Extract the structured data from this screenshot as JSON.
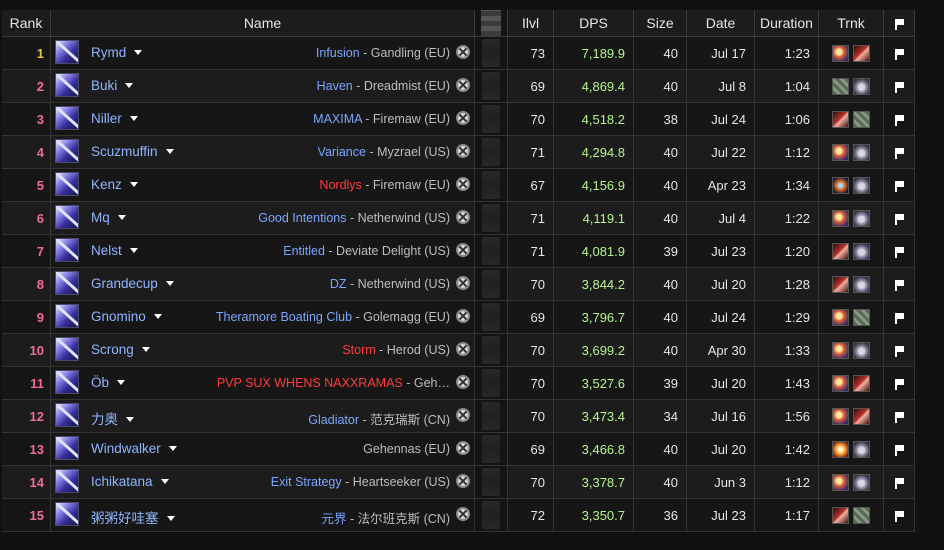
{
  "colors": {
    "rank_gold": "#e7c24a",
    "rank_pink": "#f06a9a",
    "name_blue": "#8eb6ff",
    "guild_blue": "#7aa7ff",
    "guild_red": "#ff3b3b",
    "server_gray": "#bdbdbd",
    "dps_green": "#b6f58a"
  },
  "headers": {
    "rank": "Rank",
    "name": "Name",
    "ilvl": "Ilvl",
    "dps": "DPS",
    "size": "Size",
    "date": "Date",
    "duration": "Duration",
    "trinkets": "Trnk",
    "flag_icon": "flag-icon"
  },
  "rows": [
    {
      "rank": "1",
      "name": "Rymd",
      "guild": "Infusion",
      "guild_color": "blue",
      "server": " - Gandling (EU)",
      "ilvl": "73",
      "dps": "7,189.9",
      "size": "40",
      "date": "Jul 17",
      "duration": "1:23",
      "trinkets": [
        "eye",
        "claw"
      ]
    },
    {
      "rank": "2",
      "name": "Buki",
      "guild": "Haven",
      "guild_color": "blue",
      "server": " - Dreadmist (EU)",
      "ilvl": "69",
      "dps": "4,869.4",
      "size": "40",
      "date": "Jul 8",
      "duration": "1:04",
      "trinkets": [
        "rune",
        "orb"
      ]
    },
    {
      "rank": "3",
      "name": "Niller",
      "guild": "MAXIMA",
      "guild_color": "blue",
      "server": " - Firemaw (EU)",
      "ilvl": "70",
      "dps": "4,518.2",
      "size": "38",
      "date": "Jul 24",
      "duration": "1:06",
      "trinkets": [
        "claw",
        "rune"
      ]
    },
    {
      "rank": "4",
      "name": "Scuzmuffin",
      "guild": "Variance",
      "guild_color": "blue",
      "server": " - Myzrael (US)",
      "ilvl": "71",
      "dps": "4,294.8",
      "size": "40",
      "date": "Jul 22",
      "duration": "1:12",
      "trinkets": [
        "eye",
        "orb"
      ]
    },
    {
      "rank": "5",
      "name": "Kenz",
      "guild": "Nordlys",
      "guild_color": "red",
      "server": " - Firemaw (EU)",
      "ilvl": "67",
      "dps": "4,156.9",
      "size": "40",
      "date": "Apr 23",
      "duration": "1:34",
      "trinkets": [
        "spark",
        "orb"
      ]
    },
    {
      "rank": "6",
      "name": "Mq",
      "guild": "Good Intentions",
      "guild_color": "blue",
      "server": " - Netherwind (US)",
      "ilvl": "71",
      "dps": "4,119.1",
      "size": "40",
      "date": "Jul 4",
      "duration": "1:22",
      "trinkets": [
        "eye",
        "orb"
      ]
    },
    {
      "rank": "7",
      "name": "Nelst",
      "guild": "Entitled",
      "guild_color": "blue",
      "server": " - Deviate Delight (US)",
      "ilvl": "71",
      "dps": "4,081.9",
      "size": "39",
      "date": "Jul 23",
      "duration": "1:20",
      "trinkets": [
        "claw",
        "orb"
      ]
    },
    {
      "rank": "8",
      "name": "Grandecup",
      "guild": "DZ",
      "guild_color": "blue",
      "server": " - Netherwind (US)",
      "ilvl": "70",
      "dps": "3,844.2",
      "size": "40",
      "date": "Jul 20",
      "duration": "1:28",
      "trinkets": [
        "claw",
        "orb"
      ]
    },
    {
      "rank": "9",
      "name": "Gnomino",
      "guild": "Theramore Boating Club",
      "guild_color": "blue",
      "server": " - Golemagg (EU)",
      "ilvl": "69",
      "dps": "3,796.7",
      "size": "40",
      "date": "Jul 24",
      "duration": "1:29",
      "trinkets": [
        "eye",
        "rune"
      ]
    },
    {
      "rank": "10",
      "name": "Scrong",
      "guild": "Storm",
      "guild_color": "red",
      "server": " - Herod (US)",
      "ilvl": "70",
      "dps": "3,699.2",
      "size": "40",
      "date": "Apr 30",
      "duration": "1:33",
      "trinkets": [
        "eye",
        "orb"
      ]
    },
    {
      "rank": "11",
      "name": "Öb",
      "guild": "PVP SUX WHENS NAXXRAMAS",
      "guild_color": "red",
      "server": " - Geh…",
      "ilvl": "70",
      "dps": "3,527.6",
      "size": "39",
      "date": "Jul 20",
      "duration": "1:43",
      "trinkets": [
        "eye",
        "claw"
      ]
    },
    {
      "rank": "12",
      "name": "力奥",
      "guild": "Gladiator",
      "guild_color": "blue",
      "server": " - 范克瑞斯 (CN)",
      "ilvl": "70",
      "dps": "3,473.4",
      "size": "34",
      "date": "Jul 16",
      "duration": "1:56",
      "trinkets": [
        "eye",
        "claw"
      ]
    },
    {
      "rank": "13",
      "name": "Windwalker",
      "guild": "",
      "guild_color": "blue",
      "server": "Gehennas (EU)",
      "ilvl": "69",
      "dps": "3,466.8",
      "size": "40",
      "date": "Jul 20",
      "duration": "1:42",
      "trinkets": [
        "burst",
        "orb"
      ]
    },
    {
      "rank": "14",
      "name": "Ichikatana",
      "guild": "Exit Strategy",
      "guild_color": "blue",
      "server": " - Heartseeker (US)",
      "ilvl": "70",
      "dps": "3,378.7",
      "size": "40",
      "date": "Jun 3",
      "duration": "1:12",
      "trinkets": [
        "eye",
        "orb"
      ]
    },
    {
      "rank": "15",
      "name": "粥粥好哇塞",
      "guild": "元界",
      "guild_color": "blue",
      "server": " - 法尔班克斯 (CN)",
      "ilvl": "72",
      "dps": "3,350.7",
      "size": "36",
      "date": "Jul 23",
      "duration": "1:17",
      "trinkets": [
        "claw",
        "rune"
      ]
    }
  ]
}
